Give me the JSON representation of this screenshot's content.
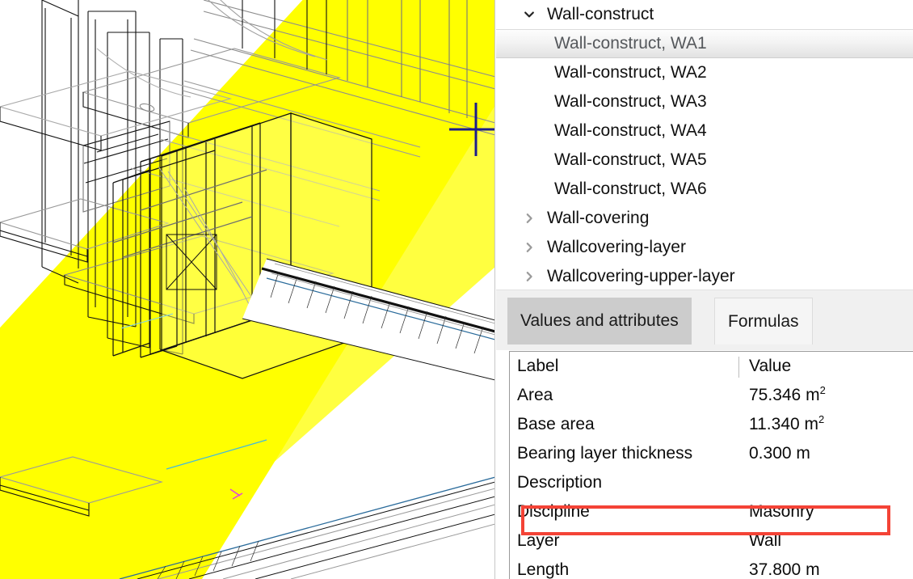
{
  "viewport": {
    "name": "3d-cad-wireframe-viewport",
    "selection_color": "#ffff00",
    "cursor": "crosshair-cursor",
    "cursor_color": "#1c1c8c"
  },
  "tree": {
    "rows": [
      {
        "label": "Wall-construct",
        "icon": "chevron-down-icon",
        "level": 0,
        "selected": false,
        "expanded": true
      },
      {
        "label": "Wall-construct, WA1",
        "icon": "none",
        "level": 1,
        "selected": true,
        "expanded": false
      },
      {
        "label": "Wall-construct, WA2",
        "icon": "none",
        "level": 1,
        "selected": false,
        "expanded": false
      },
      {
        "label": "Wall-construct, WA3",
        "icon": "none",
        "level": 1,
        "selected": false,
        "expanded": false
      },
      {
        "label": "Wall-construct, WA4",
        "icon": "none",
        "level": 1,
        "selected": false,
        "expanded": false
      },
      {
        "label": "Wall-construct, WA5",
        "icon": "none",
        "level": 1,
        "selected": false,
        "expanded": false
      },
      {
        "label": "Wall-construct, WA6",
        "icon": "none",
        "level": 1,
        "selected": false,
        "expanded": false
      },
      {
        "label": "Wall-covering",
        "icon": "chevron-right-icon",
        "level": 0,
        "selected": false,
        "expanded": false
      },
      {
        "label": "Wallcovering-layer",
        "icon": "chevron-right-icon",
        "level": 0,
        "selected": false,
        "expanded": false
      },
      {
        "label": "Wallcovering-upper-layer",
        "icon": "chevron-right-icon",
        "level": 0,
        "selected": false,
        "expanded": false
      }
    ]
  },
  "tabs": [
    {
      "label": "Values and attributes",
      "active": true
    },
    {
      "label": "Formulas",
      "active": false
    }
  ],
  "table": {
    "columns": {
      "label": "Label",
      "value": "Value"
    },
    "rows": [
      {
        "label": "Area",
        "value": "75.346 m",
        "sup": "2"
      },
      {
        "label": "Base area",
        "value": "11.340 m",
        "sup": "2"
      },
      {
        "label": "Bearing layer thickness",
        "value": "0.300 m",
        "sup": ""
      },
      {
        "label": "Description",
        "value": "",
        "sup": ""
      },
      {
        "label": "Discipline",
        "value": "Masonry",
        "sup": ""
      },
      {
        "label": "Layer",
        "value": "Wall",
        "sup": ""
      },
      {
        "label": "Length",
        "value": "37.800 m",
        "sup": ""
      }
    ],
    "highlighted_row_label": "Discipline",
    "highlight_color": "#f44336"
  }
}
